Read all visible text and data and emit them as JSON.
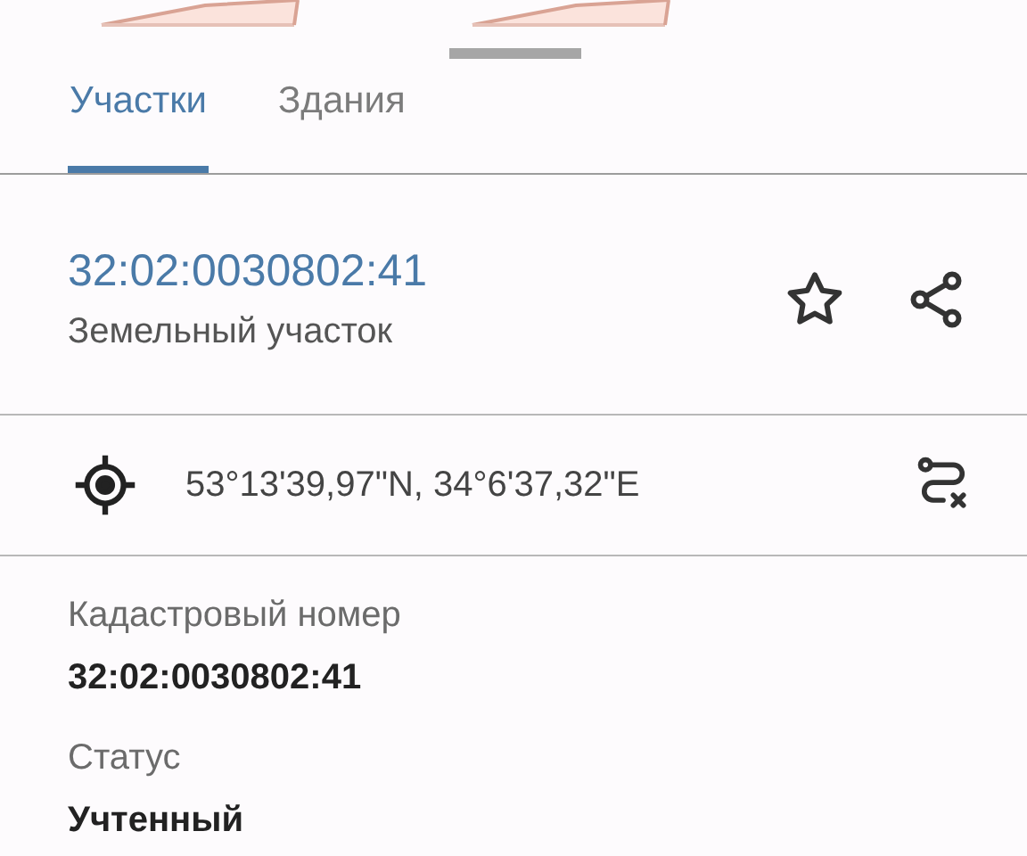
{
  "tabs": [
    {
      "label": "Участки",
      "selected": true
    },
    {
      "label": "Здания",
      "selected": false
    }
  ],
  "parcel": {
    "number": "32:02:0030802:41",
    "type": "Земельный участок",
    "favorite": false
  },
  "coordinates": "53°13'39,97\"N, 34°6'37,32\"E",
  "fields": [
    {
      "label": "Кадастровый номер",
      "value": "32:02:0030802:41"
    },
    {
      "label": "Статус",
      "value": "Учтенный"
    }
  ]
}
